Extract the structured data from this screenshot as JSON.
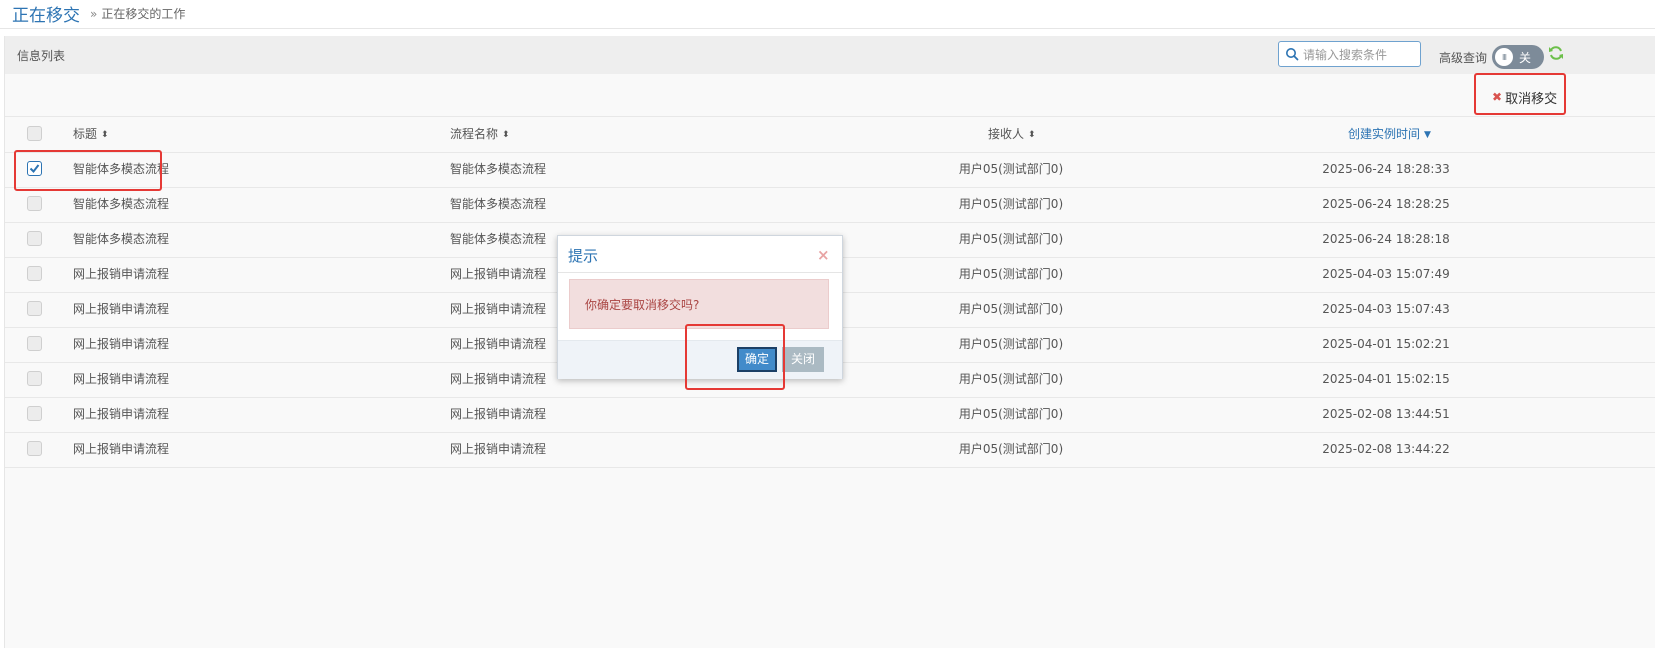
{
  "header": {
    "title": "正在移交",
    "breadcrumb_sep": "»",
    "breadcrumb": "正在移交的工作"
  },
  "panel": {
    "title": "信息列表",
    "search_placeholder": "请输入搜索条件",
    "advanced_label": "高级查询",
    "toggle_knob": "III",
    "toggle_text": "关",
    "cancel_transfer_label": "取消移交"
  },
  "table": {
    "columns": [
      "标题",
      "流程名称",
      "接收人",
      "创建实例时间"
    ],
    "rows": [
      {
        "checked": true,
        "title": "智能体多模态流程",
        "flow": "智能体多模态流程",
        "receiver": "用户05(测试部门0)",
        "time": "2025-06-24 18:28:33"
      },
      {
        "checked": false,
        "title": "智能体多模态流程",
        "flow": "智能体多模态流程",
        "receiver": "用户05(测试部门0)",
        "time": "2025-06-24 18:28:25"
      },
      {
        "checked": false,
        "title": "智能体多模态流程",
        "flow": "智能体多模态流程",
        "receiver": "用户05(测试部门0)",
        "time": "2025-06-24 18:28:18"
      },
      {
        "checked": false,
        "title": "网上报销申请流程",
        "flow": "网上报销申请流程",
        "receiver": "用户05(测试部门0)",
        "time": "2025-04-03 15:07:49"
      },
      {
        "checked": false,
        "title": "网上报销申请流程",
        "flow": "网上报销申请流程",
        "receiver": "用户05(测试部门0)",
        "time": "2025-04-03 15:07:43"
      },
      {
        "checked": false,
        "title": "网上报销申请流程",
        "flow": "网上报销申请流程",
        "receiver": "用户05(测试部门0)",
        "time": "2025-04-01 15:02:21"
      },
      {
        "checked": false,
        "title": "网上报销申请流程",
        "flow": "网上报销申请流程",
        "receiver": "用户05(测试部门0)",
        "time": "2025-04-01 15:02:15"
      },
      {
        "checked": false,
        "title": "网上报销申请流程",
        "flow": "网上报销申请流程",
        "receiver": "用户05(测试部门0)",
        "time": "2025-02-08 13:44:51"
      },
      {
        "checked": false,
        "title": "网上报销申请流程",
        "flow": "网上报销申请流程",
        "receiver": "用户05(测试部门0)",
        "time": "2025-02-08 13:44:22"
      }
    ]
  },
  "dialog": {
    "title": "提示",
    "message": "你确定要取消移交吗?",
    "ok_label": "确定",
    "close_label": "关闭"
  },
  "icons": {
    "sort": "sort-icon",
    "sort_desc": "sort-desc-icon",
    "search": "search-icon",
    "refresh": "refresh-icon",
    "close": "close-icon",
    "cancel": "x-icon"
  },
  "colors": {
    "accent": "#2d74b3",
    "highlight": "#e53935",
    "alert_bg": "#f2dede",
    "alert_text": "#a94442",
    "ok_button": "#428bca",
    "close_button": "#abbac3",
    "refresh": "#6cbf4a"
  }
}
